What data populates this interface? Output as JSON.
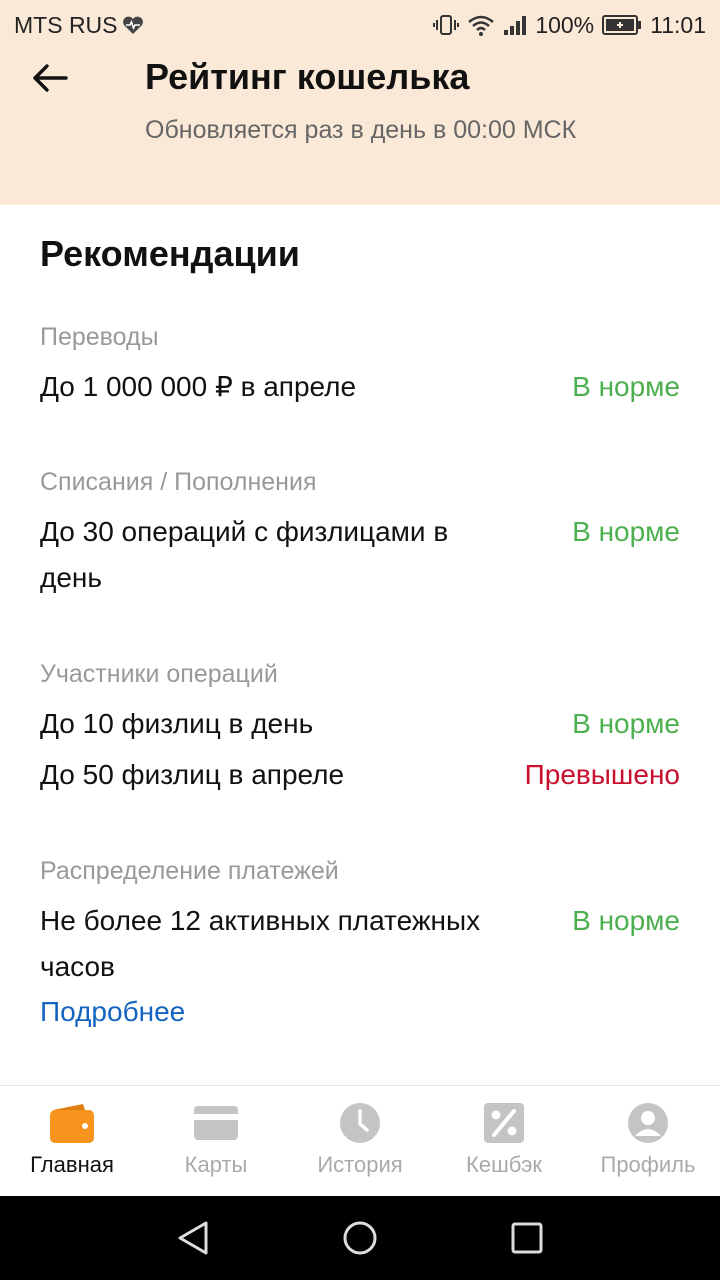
{
  "status_bar": {
    "carrier": "MTS RUS",
    "battery": "100%",
    "time": "11:01"
  },
  "header": {
    "title": "Рейтинг кошелька",
    "subtitle": "Обновляется раз в день в 00:00 МСК"
  },
  "recommendations": {
    "title": "Рекомендации",
    "groups": [
      {
        "category": "Переводы",
        "rows": [
          {
            "text": "До 1 000 000 ₽ в апреле",
            "status": "В норме"
          }
        ]
      },
      {
        "category": "Списания / Пополнения",
        "rows": [
          {
            "text": "До 30 операций с физлицами в день",
            "status": "В норме"
          }
        ]
      },
      {
        "category": "Участники операций",
        "rows": [
          {
            "text": "До 10 физлиц в день",
            "status": "В норме"
          },
          {
            "text": "До 50 физлиц в апреле",
            "status": "Превышено"
          }
        ]
      },
      {
        "category": "Распределение платежей",
        "rows": [
          {
            "text": "Не более 12 активных платежных часов",
            "status": "В норме"
          }
        ],
        "link": "Подробнее"
      }
    ]
  },
  "tabbar": {
    "items": [
      {
        "label": "Главная",
        "icon": "wallet-icon",
        "active": true
      },
      {
        "label": "Карты",
        "icon": "card-icon"
      },
      {
        "label": "История",
        "icon": "clock-icon"
      },
      {
        "label": "Кешбэк",
        "icon": "percent-icon"
      },
      {
        "label": "Профиль",
        "icon": "profile-icon"
      }
    ]
  },
  "colors": {
    "header_bg": "#fbe9d8",
    "ok": "#4caf50",
    "exceeded": "#c8102e",
    "link": "#1565c0",
    "accent": "#f7941d"
  }
}
